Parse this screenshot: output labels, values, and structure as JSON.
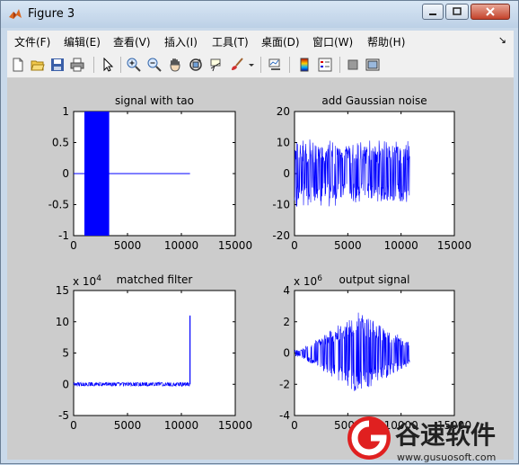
{
  "window": {
    "title": "Figure 3"
  },
  "menu": [
    "文件(F)",
    "编辑(E)",
    "查看(V)",
    "插入(I)",
    "工具(T)",
    "桌面(D)",
    "窗口(W)",
    "帮助(H)"
  ],
  "menu_more": "↘",
  "toolbar": [
    {
      "name": "new-figure-icon"
    },
    {
      "name": "open-file-icon"
    },
    {
      "name": "save-icon"
    },
    {
      "name": "print-icon"
    },
    {
      "name": "pointer-icon"
    },
    {
      "name": "zoom-in-icon"
    },
    {
      "name": "zoom-out-icon"
    },
    {
      "name": "pan-hand-icon"
    },
    {
      "name": "rotate-3d-icon"
    },
    {
      "name": "data-cursor-icon"
    },
    {
      "name": "brush-icon"
    },
    {
      "name": "brush-dropdown-icon"
    },
    {
      "name": "link-plot-icon"
    },
    {
      "name": "colorbar-icon"
    },
    {
      "name": "legend-icon"
    },
    {
      "name": "hide-plot-tools-icon"
    },
    {
      "name": "show-plot-tools-icon"
    }
  ],
  "watermark": {
    "brand": "谷速软件",
    "url": "www.gusuosoft.com"
  },
  "chart_data": [
    {
      "type": "line",
      "title": "signal with tao",
      "xlabel": "",
      "ylabel": "",
      "exponent": "",
      "xlim": [
        0,
        15000
      ],
      "ylim": [
        -1,
        1
      ],
      "xticks": [
        "0",
        "5000",
        "10000",
        "15000"
      ],
      "yticks": [
        "1",
        "0.5",
        "0",
        "-0.5",
        "-1"
      ],
      "xtickvals": [
        0,
        5000,
        10000,
        15000
      ],
      "ytickvals": [
        1,
        0.5,
        0,
        -0.5,
        -1
      ],
      "series": [
        {
          "kind": "burst",
          "x": [
            1000,
            3300
          ],
          "ymin": -1,
          "ymax": 1
        },
        {
          "kind": "flat",
          "x": [
            0,
            10800
          ],
          "y": 0
        }
      ],
      "color": "#0000ff"
    },
    {
      "type": "line",
      "title": "add Gaussian noise",
      "xlabel": "",
      "ylabel": "",
      "exponent": "",
      "xlim": [
        0,
        15000
      ],
      "ylim": [
        -20,
        20
      ],
      "xticks": [
        "0",
        "5000",
        "10000",
        "15000"
      ],
      "yticks": [
        "20",
        "10",
        "0",
        "-10",
        "-20"
      ],
      "xtickvals": [
        0,
        5000,
        10000,
        15000
      ],
      "ytickvals": [
        20,
        10,
        0,
        -10,
        -20
      ],
      "series": [
        {
          "kind": "noise",
          "x": [
            0,
            10800
          ],
          "amp": [
            9,
            11,
            7
          ]
        }
      ],
      "color": "#0000ff"
    },
    {
      "type": "line",
      "title": "matched filter",
      "xlabel": "",
      "ylabel": "",
      "exponent": "x 10^4",
      "xlim": [
        0,
        15000
      ],
      "ylim": [
        -5,
        15
      ],
      "xticks": [
        "0",
        "5000",
        "10000",
        "15000"
      ],
      "yticks": [
        "15",
        "10",
        "5",
        "0",
        "-5"
      ],
      "xtickvals": [
        0,
        5000,
        10000,
        15000
      ],
      "ytickvals": [
        15,
        10,
        5,
        0,
        -5
      ],
      "series": [
        {
          "kind": "noise",
          "x": [
            0,
            10800
          ],
          "amp": [
            0.3,
            0.3,
            0.3
          ]
        },
        {
          "kind": "spike",
          "x": 10800,
          "y": 11
        }
      ],
      "color": "#0000ff"
    },
    {
      "type": "line",
      "title": "output signal",
      "xlabel": "",
      "ylabel": "",
      "exponent": "x 10^6",
      "xlim": [
        0,
        15000
      ],
      "ylim": [
        -4,
        4
      ],
      "xticks": [
        "0",
        "5000",
        "10000",
        "15000"
      ],
      "yticks": [
        "4",
        "2",
        "0",
        "-2",
        "-4"
      ],
      "xtickvals": [
        0,
        5000,
        10000,
        15000
      ],
      "ytickvals": [
        4,
        2,
        0,
        -2,
        -4
      ],
      "series": [
        {
          "kind": "envelope",
          "x": [
            0,
            10800
          ],
          "peak_x": 6000,
          "peak": 2.6
        }
      ],
      "color": "#0000ff"
    }
  ]
}
